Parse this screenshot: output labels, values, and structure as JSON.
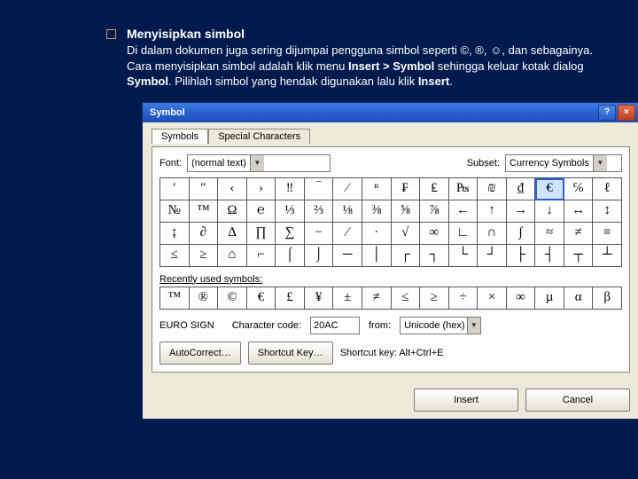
{
  "slide": {
    "heading": "Menyisipkan simbol",
    "body_pre": "Di dalam dokumen juga sering dijumpai pengguna simbol seperti ©, ®, ☺, dan sebagainya. Cara menyisipkan simbol adalah klik menu ",
    "b1": "Insert > Symbol",
    "mid1": " sehingga keluar kotak dialog ",
    "b2": "Symbol",
    "mid2": ". Pilihlah simbol yang hendak digunakan lalu klik ",
    "b3": "Insert",
    "tail": "."
  },
  "dialog": {
    "title": "Symbol",
    "tabs": {
      "symbols": "Symbols",
      "special": "Special Characters"
    },
    "font_label": "Font:",
    "font_value": "(normal text)",
    "subset_label": "Subset:",
    "subset_value": "Currency Symbols",
    "grid_rows": [
      [
        "′",
        "″",
        "‹",
        "›",
        "‼",
        "‾",
        "⁄",
        "ⁿ",
        "₣",
        "₤",
        "₧",
        "₪",
        "₫",
        "€",
        "℅",
        "ℓ"
      ],
      [
        "№",
        "™",
        "Ω",
        "℮",
        "⅓",
        "⅔",
        "⅛",
        "⅜",
        "⅝",
        "⅞",
        "←",
        "↑",
        "→",
        "↓",
        "↔",
        "↕"
      ],
      [
        "↨",
        "∂",
        "∆",
        "∏",
        "∑",
        "−",
        "∕",
        "∙",
        "√",
        "∞",
        "∟",
        "∩",
        "∫",
        "≈",
        "≠",
        "≡"
      ],
      [
        "≤",
        "≥",
        "⌂",
        "⌐",
        "⌠",
        "⌡",
        "─",
        "│",
        "┌",
        "┐",
        "└",
        "┘",
        "├",
        "┤",
        "┬",
        "┴"
      ]
    ],
    "selected": {
      "row": 0,
      "col": 13
    },
    "recent_label": "Recently used symbols:",
    "recent": [
      "™",
      "®",
      "©",
      "€",
      "£",
      "¥",
      "±",
      "≠",
      "≤",
      "≥",
      "÷",
      "×",
      "∞",
      "µ",
      "α",
      "β"
    ],
    "char_name": "EURO SIGN",
    "code_label": "Character code:",
    "code_value": "20AC",
    "from_label": "from:",
    "from_value": "Unicode (hex)",
    "btn_autocorrect": "AutoCorrect…",
    "btn_shortcut": "Shortcut Key…",
    "shortcut_label": "Shortcut key: Alt+Ctrl+E",
    "btn_insert": "Insert",
    "btn_cancel": "Cancel"
  }
}
